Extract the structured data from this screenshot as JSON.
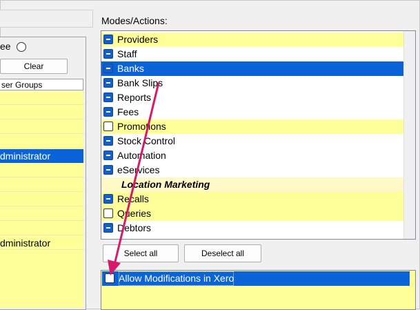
{
  "left": {
    "radio_label": "ee",
    "clear_label": "Clear",
    "column_header": "ser Groups",
    "rows": [
      {
        "label": "",
        "selected": false
      },
      {
        "label": "",
        "selected": false
      },
      {
        "label": "",
        "selected": false
      },
      {
        "label": "",
        "selected": false
      },
      {
        "label": "dministrator",
        "selected": true
      },
      {
        "label": "",
        "selected": false
      },
      {
        "label": "",
        "selected": false
      },
      {
        "label": "",
        "selected": false
      },
      {
        "label": "",
        "selected": false
      },
      {
        "label": "",
        "selected": false
      },
      {
        "label": "dministrator",
        "selected": false
      }
    ]
  },
  "right": {
    "modes_label": "Modes/Actions:",
    "items": [
      {
        "label": "Providers",
        "state": "minus",
        "style": "yellow"
      },
      {
        "label": "Staff",
        "state": "minus",
        "style": "white"
      },
      {
        "label": "Banks",
        "state": "minus",
        "style": "sel"
      },
      {
        "label": "Bank Slips",
        "state": "minus",
        "style": "white"
      },
      {
        "label": "Reports",
        "state": "minus",
        "style": "white"
      },
      {
        "label": "Fees",
        "state": "minus",
        "style": "white"
      },
      {
        "label": "Promotions",
        "state": "empty",
        "style": "yellow"
      },
      {
        "label": "Stock Control",
        "state": "minus",
        "style": "white"
      },
      {
        "label": "Automation",
        "state": "minus",
        "style": "white"
      },
      {
        "label": "eServices",
        "state": "minus",
        "style": "white"
      },
      {
        "label": "Location Marketing",
        "state": "header",
        "style": "pale"
      },
      {
        "label": "Recalls",
        "state": "minus",
        "style": "yellow"
      },
      {
        "label": "Queries",
        "state": "empty",
        "style": "yellow"
      },
      {
        "label": "Debtors",
        "state": "minus",
        "style": "white"
      }
    ],
    "select_all_label": "Select all",
    "deselect_all_label": "Deselect all",
    "bottom_item_label": "Allow Modifications in Xero"
  },
  "colors": {
    "selection": "#0a64d8",
    "list_yellow": "#ffff99",
    "arrow": "#d6196a"
  }
}
